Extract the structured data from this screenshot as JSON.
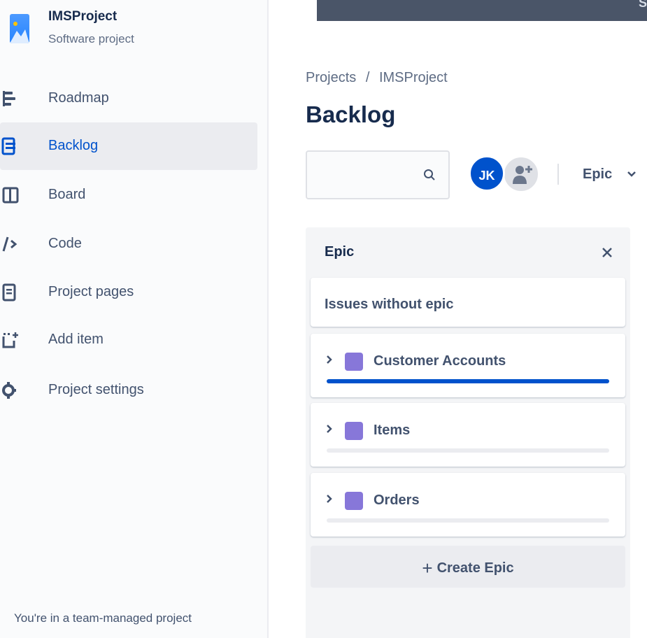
{
  "project": {
    "name": "IMSProject",
    "type": "Software project"
  },
  "sidebar": {
    "items": [
      {
        "label": "Roadmap",
        "icon": "roadmap-icon",
        "active": false
      },
      {
        "label": "Backlog",
        "icon": "backlog-icon",
        "active": true
      },
      {
        "label": "Board",
        "icon": "board-icon",
        "active": false
      },
      {
        "label": "Code",
        "icon": "code-icon",
        "active": false
      },
      {
        "label": "Project pages",
        "icon": "pages-icon",
        "active": false
      },
      {
        "label": "Add item",
        "icon": "add-item-icon",
        "active": false
      },
      {
        "label": "Project settings",
        "icon": "gear-icon",
        "active": false
      }
    ],
    "footer_note": "You're in a team-managed project"
  },
  "topbar": {
    "partial_text": "S"
  },
  "breadcrumb": {
    "items": [
      "Projects",
      "IMSProject"
    ],
    "separator": "/"
  },
  "page": {
    "title": "Backlog"
  },
  "toolbar": {
    "search_placeholder": "",
    "avatar_initials": "JK",
    "epic_filter_label": "Epic"
  },
  "epic_panel": {
    "title": "Epic",
    "no_epic_label": "Issues without epic",
    "epics": [
      {
        "name": "Customer Accounts",
        "color": "#8777d9",
        "progress": 1.0
      },
      {
        "name": "Items",
        "color": "#8777d9",
        "progress": 0.0
      },
      {
        "name": "Orders",
        "color": "#8777d9",
        "progress": 0.0
      }
    ],
    "create_label": "Create Epic",
    "create_icon": "+"
  },
  "colors": {
    "accent": "#0052cc",
    "active_nav_bg": "#ebecf0",
    "epic_purple": "#8777d9"
  }
}
